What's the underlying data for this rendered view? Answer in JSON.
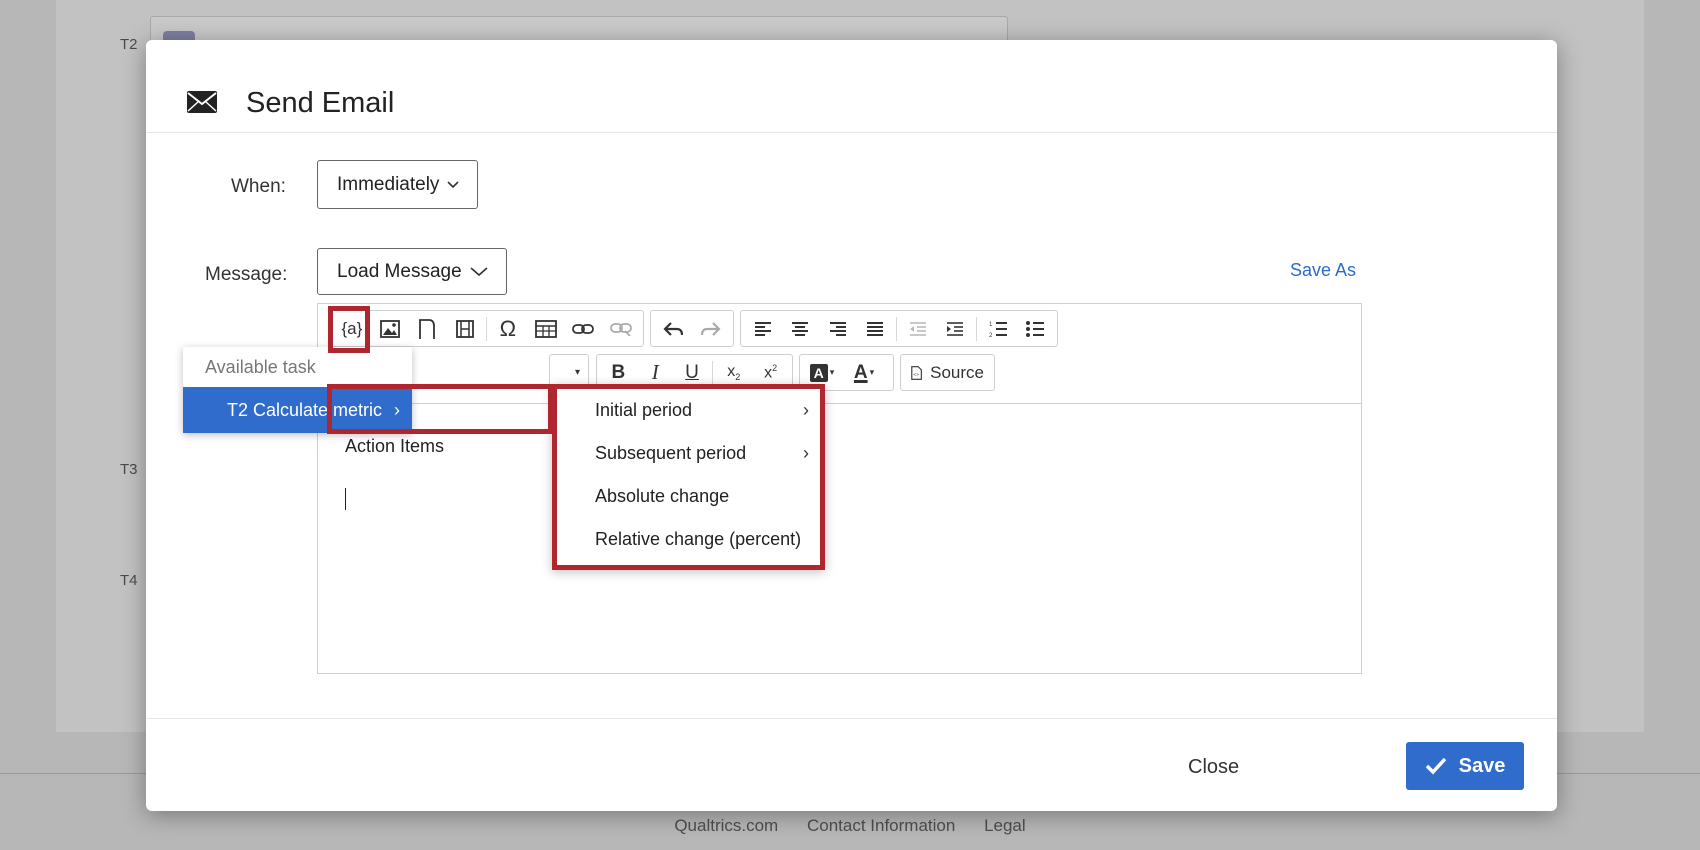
{
  "background": {
    "row_labels": [
      "T2",
      "T3",
      "T4"
    ],
    "footer_links": [
      "Qualtrics.com",
      "Contact Information",
      "Legal"
    ]
  },
  "modal": {
    "title": "Send Email",
    "icon": "envelope-icon"
  },
  "when": {
    "label": "When:",
    "value": "Immediately"
  },
  "message": {
    "label": "Message:",
    "load_message": "Load Message",
    "save_as": "Save As"
  },
  "toolbar": {
    "row1": [
      "piped-text-icon",
      "image-icon",
      "flag-icon",
      "film-icon",
      "omega-icon",
      "table-icon",
      "link-icon",
      "unlink-icon",
      "undo-icon",
      "redo-icon",
      "align-left-icon",
      "align-center-icon",
      "align-right-icon",
      "justify-icon",
      "outdent-icon",
      "indent-icon",
      "numbered-list-icon",
      "bullet-list-icon"
    ],
    "source_label": "Source"
  },
  "editor": {
    "text": "Action Items"
  },
  "piped_menu": {
    "header": "Available task",
    "active_item": "T2 Calculate metric"
  },
  "submenu": {
    "items": [
      {
        "label": "Initial period",
        "has_submenu": true
      },
      {
        "label": "Subsequent period",
        "has_submenu": true
      },
      {
        "label": "Absolute change",
        "has_submenu": false
      },
      {
        "label": "Relative change (percent)",
        "has_submenu": false
      }
    ]
  },
  "footer": {
    "close_label": "Close",
    "save_label": "Save"
  },
  "colors": {
    "accent": "#2f6ccb",
    "highlight": "#b0262f"
  }
}
